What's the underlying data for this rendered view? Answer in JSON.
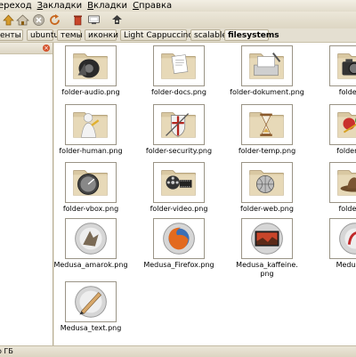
{
  "menu": {
    "items": [
      {
        "pre": "",
        "u": "",
        "post": "ереход"
      },
      {
        "pre": "",
        "u": "З",
        "post": "акладки"
      },
      {
        "pre": "",
        "u": "В",
        "post": "кладки"
      },
      {
        "pre": "",
        "u": "С",
        "post": "правка"
      }
    ]
  },
  "toolbar": {
    "icons": [
      "up-arrow-icon",
      "home-icon",
      "stop-icon",
      "reload-icon",
      "trash-icon",
      "computer-icon",
      "network-icon"
    ]
  },
  "pathbar": {
    "crumbs": [
      "енты",
      "ubuntu",
      "темы",
      "иконки",
      "Light Cappuccino",
      "scalable",
      "filesystems"
    ],
    "active_index": 6
  },
  "sidebar": {
    "close_icon": "close-icon"
  },
  "files": [
    {
      "name": "folder-audio.png",
      "icon": "audio-speaker"
    },
    {
      "name": "folder-docs.png",
      "icon": "documents"
    },
    {
      "name": "folder-dokument.png",
      "icon": "document-tray"
    },
    {
      "name": "folder-fot",
      "icon": "camera"
    },
    {
      "name": "folder-human.png",
      "icon": "human-figure"
    },
    {
      "name": "folder-security.png",
      "icon": "shield-sword"
    },
    {
      "name": "folder-temp.png",
      "icon": "hourglass"
    },
    {
      "name": "folder-trav",
      "icon": "travel"
    },
    {
      "name": "folder-vbox.png",
      "icon": "gauge"
    },
    {
      "name": "folder-video.png",
      "icon": "film-reel"
    },
    {
      "name": "folder-web.png",
      "icon": "globe"
    },
    {
      "name": "folder-wo",
      "icon": "hat"
    },
    {
      "name": "Medusa_amarok.png",
      "icon": "amarok-wolf"
    },
    {
      "name": "Medusa_Firefox.png",
      "icon": "firefox"
    },
    {
      "name": "Medusa_kaffeine.\npng",
      "icon": "kaffeine-screen"
    },
    {
      "name": "Medusa_m",
      "icon": "medusa-red"
    },
    {
      "name": "Medusa_text.png",
      "icon": "pen-text"
    }
  ],
  "status": {
    "text": "о ГБ"
  },
  "colors": {
    "folder": "#d6c4a0",
    "accent_red": "#d4542e",
    "chrome": "#e9e4d6"
  }
}
